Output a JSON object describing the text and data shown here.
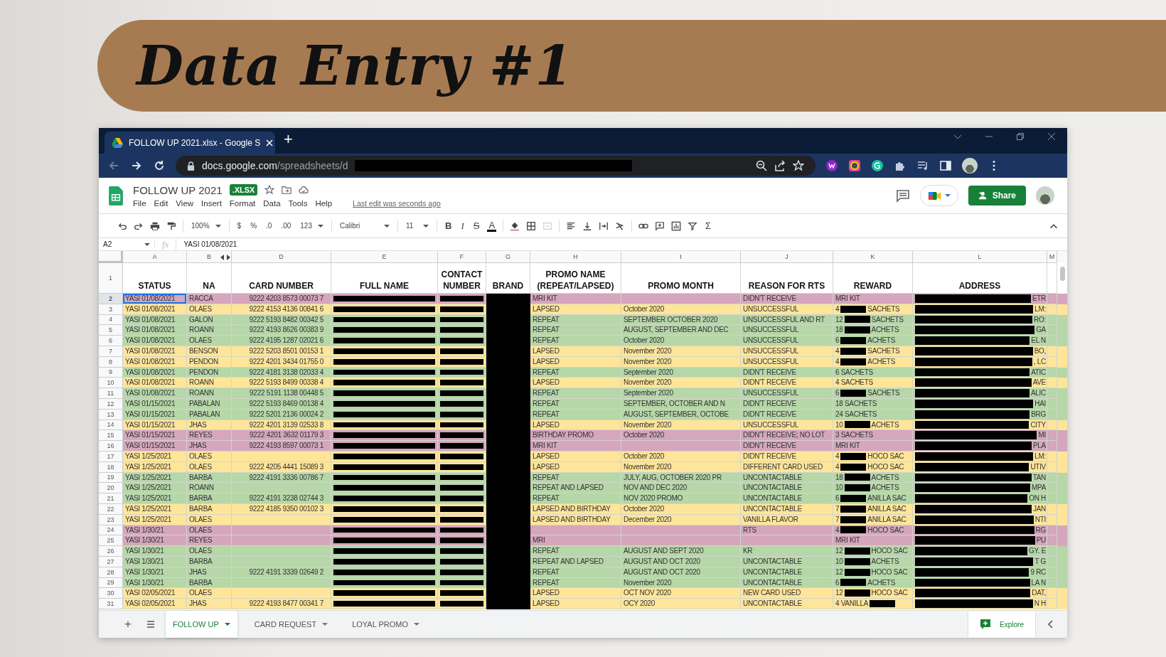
{
  "banner": {
    "title": "Data Entry #1"
  },
  "browser": {
    "tab_title": "FOLLOW UP 2021.xlsx - Google S",
    "new_tab": "+",
    "url_host": "docs.google.com",
    "url_path": "/spreadsheets/d"
  },
  "doc": {
    "title": "FOLLOW UP 2021",
    "badge": ".XLSX",
    "menus": [
      "File",
      "Edit",
      "View",
      "Insert",
      "Format",
      "Data",
      "Tools",
      "Help"
    ],
    "last_edit": "Last edit was seconds ago",
    "share": "Share"
  },
  "toolbar": {
    "zoom": "100%",
    "currency": "$",
    "percent": "%",
    "decrease_decimals": ".0",
    "increase_decimals": ".00",
    "number_format": "123",
    "font": "Calibri",
    "font_size": "11",
    "bold": "B",
    "italic": "I",
    "strikethrough": "S",
    "text_color": "A",
    "functions": "Σ"
  },
  "formula_bar": {
    "cell": "A2",
    "fx": "fx",
    "value": "YASI 01/08/2021"
  },
  "columns": [
    {
      "letter": "A",
      "label": "STATUS"
    },
    {
      "letter": "B",
      "label": "NA"
    },
    {
      "letter": "D",
      "label": "CARD NUMBER"
    },
    {
      "letter": "E",
      "label": "FULL NAME"
    },
    {
      "letter": "F",
      "label": "CONTACT NUMBER"
    },
    {
      "letter": "G",
      "label": "BRAND"
    },
    {
      "letter": "H",
      "label": "PROMO NAME (REPEAT/LAPSED)"
    },
    {
      "letter": "I",
      "label": "PROMO MONTH"
    },
    {
      "letter": "J",
      "label": "REASON FOR RTS"
    },
    {
      "letter": "K",
      "label": "REWARD"
    },
    {
      "letter": "L",
      "label": "ADDRESS"
    },
    {
      "letter": "M"
    }
  ],
  "header_row_number": "1",
  "rows": [
    {
      "n": "2",
      "color": "#d5a6bd",
      "selected": true,
      "redacted": true,
      "status": "YASI 01/08/2021",
      "na": "RACCA",
      "card": "9222 4203 8573 00073 7",
      "promo": "MRI KIT",
      "reason": "DIDN'T RECEIVE",
      "reward": {
        "lead": "MRI KIT",
        "redacted": false
      },
      "address_tail": "ETR"
    },
    {
      "n": "3",
      "color": "#ffe599",
      "selected": false,
      "redacted": true,
      "status": "YASI 01/08/2021",
      "na": "OLAES",
      "card": "9222 4153 4136 00841 6",
      "promo": "LAPSED",
      "month": "October 2020",
      "reason": "UNSUCCESSFUL",
      "reward": {
        "lead": "4",
        "redacted": true,
        "tail": "SACHETS"
      },
      "address_tail": "LM:"
    },
    {
      "n": "4",
      "color": "#b6d7a8",
      "selected": false,
      "redacted": true,
      "status": "YASI 01/08/2021",
      "na": "GALON",
      "card": "9222 5193 8482 00342 5",
      "promo": "REPEAT",
      "month": "SEPTEMBER OCTOBER 2020",
      "reason": "UNSUCCESSFUL AND RT",
      "reward": {
        "lead": "12",
        "redacted": true,
        "tail": "SACHETS"
      },
      "address_tail": "RO:"
    },
    {
      "n": "5",
      "color": "#b6d7a8",
      "selected": false,
      "redacted": true,
      "status": "YASI 01/08/2021",
      "na": "ROANN",
      "card": "9222 4193 8626 00383 9",
      "promo": "REPEAT",
      "month": "AUGUST, SEPTEMBER AND DEC",
      "reason": "UNSUCCESSFUL",
      "reward": {
        "lead": "18",
        "redacted": true,
        "tail": "ACHETS"
      },
      "address_tail": "GA"
    },
    {
      "n": "6",
      "color": "#b6d7a8",
      "selected": false,
      "redacted": true,
      "status": "YASI 01/08/2021",
      "na": "OLAES",
      "card": "9222 4195 1287 02021 6",
      "promo": "REPEAT",
      "month": "October 2020",
      "reason": "UNSUCCESSFUL",
      "reward": {
        "lead": "6",
        "redacted": true,
        "tail": "ACHETS"
      },
      "address_tail": "EL N"
    },
    {
      "n": "7",
      "color": "#ffe599",
      "selected": false,
      "redacted": true,
      "status": "YASI 01/08/2021",
      "na": "BENSON",
      "card": "9222 5203 8501 00153 1",
      "promo": "LAPSED",
      "month": "November 2020",
      "reason": "UNSUCCESSFUL",
      "reward": {
        "lead": "4",
        "redacted": true,
        "tail": "SACHETS"
      },
      "address_tail": "BO,"
    },
    {
      "n": "8",
      "color": "#ffe599",
      "selected": false,
      "redacted": true,
      "status": "YASI 01/08/2021",
      "na": "PENDON",
      "card": "9222 4201 3434 01755 0",
      "promo": "LAPSED",
      "month": "November 2020",
      "reason": "UNSUCCESSFUL",
      "reward": {
        "lead": "4",
        "redacted": true,
        "tail": "ACHETS"
      },
      "address_tail": ", LC"
    },
    {
      "n": "9",
      "color": "#b6d7a8",
      "selected": false,
      "redacted": true,
      "status": "YASI 01/08/2021",
      "na": "PENDON",
      "card": "9222 4181 3138 02033 4",
      "promo": "REPEAT",
      "month": "September 2020",
      "reason": "DIDN'T RECEIVE",
      "reward": {
        "lead": "6 SACHETS",
        "redacted": false
      },
      "address_tail": "ATIC"
    },
    {
      "n": "10",
      "color": "#ffe599",
      "selected": false,
      "redacted": true,
      "status": "YASI 01/08/2021",
      "na": "ROANN",
      "card": "9222 5193 8499 00338 4",
      "promo": "LAPSED",
      "month": "November 2020",
      "reason": "DIDN'T RECEIVE",
      "reward": {
        "lead": "4 SACHETS",
        "redacted": false
      },
      "address_tail": "AVE"
    },
    {
      "n": "11",
      "color": "#b6d7a8",
      "selected": false,
      "redacted": true,
      "status": "YASI 01/08/2021",
      "na": "ROANN",
      "card": "9222 5191 1138 00448 5",
      "promo": "REPEAT",
      "month": "September 2020",
      "reason": "UNSUCCESSFUL",
      "reward": {
        "lead": "6",
        "redacted": true,
        "tail": "SACHETS"
      },
      "address_tail": "ALIC"
    },
    {
      "n": "12",
      "color": "#b6d7a8",
      "selected": false,
      "redacted": true,
      "status": "YASI 01/15/2021",
      "na": "PABALAN",
      "card": "9222 5193 8469 00138 4",
      "promo": "REPEAT",
      "month": "SEPTEMBER, OCTOBER AND N",
      "reason": "DIDN'T RECEIVE",
      "reward": {
        "lead": "18 SACHETS",
        "redacted": false
      },
      "address_tail": "HAI"
    },
    {
      "n": "13",
      "color": "#b6d7a8",
      "selected": false,
      "redacted": true,
      "status": "YASI 01/15/2021",
      "na": "PABALAN",
      "card": "9222 5201 2136 00024 2",
      "promo": "REPEAT",
      "month": "AUGUST, SEPTEMBER, OCTOBE",
      "reason": "DIDN'T RECEIVE",
      "reward": {
        "lead": "24 SACHETS",
        "redacted": false
      },
      "address_tail": "BRG"
    },
    {
      "n": "14",
      "color": "#ffe599",
      "selected": false,
      "redacted": true,
      "status": "YASI 01/15/2021",
      "na": "JHAS",
      "card": "9222 4201 3139 02533 8",
      "promo": "LAPSED",
      "month": "November 2020",
      "reason": "UNSUCCESSFUL",
      "reward": {
        "lead": "10",
        "redacted": true,
        "tail": "ACHETS"
      },
      "address_tail": "CITY"
    },
    {
      "n": "15",
      "color": "#d5a6bd",
      "selected": false,
      "redacted": true,
      "status": "YASI 01/15/2021",
      "na": "REYES",
      "card": "9222 4201 3632 01179 3",
      "promo": "BIRTHDAY PROMO",
      "month": "October 2020",
      "reason": "DIDN'T RECEIVE; NO LOT",
      "reward": {
        "lead": "3 SACHETS",
        "redacted": false
      },
      "address_tail": "MI"
    },
    {
      "n": "16",
      "color": "#d5a6bd",
      "selected": false,
      "redacted": true,
      "status": "YASI 01/15/2021",
      "na": "JHAS",
      "card": "9222 4193 8597 00073 1",
      "promo": "MRI KIT",
      "reason": "DIDN'T RECEIVE",
      "reward": {
        "lead": "MRI KIT",
        "redacted": false
      },
      "address_tail": "PLA"
    },
    {
      "n": "17",
      "color": "#ffe599",
      "selected": false,
      "redacted": true,
      "status": "YASI 1/25/2021",
      "na": "OLAES",
      "promo": "LAPSED",
      "month": "October 2020",
      "reason": "DIDN'T RECEIVE",
      "reward": {
        "lead": "4",
        "redacted": true,
        "tail": "HOCO SAC"
      },
      "address_tail": "LM:"
    },
    {
      "n": "18",
      "color": "#ffe599",
      "selected": false,
      "redacted": true,
      "status": "YASI 1/25/2021",
      "na": "OLAES",
      "card": "9222 4205 4441 15089 3",
      "promo": "LAPSED",
      "month": "November 2020",
      "reason": "DIFFERENT CARD USED",
      "reward": {
        "lead": "4",
        "redacted": true,
        "tail": "HOCO SAC"
      },
      "address_tail": "UTIV"
    },
    {
      "n": "19",
      "color": "#b6d7a8",
      "selected": false,
      "redacted": true,
      "status": "YASI 1/25/2021",
      "na": "BARBA",
      "card": "9222 4191 3336 00786 7",
      "promo": "REPEAT",
      "month": "JULY, AUG, OCTOBER 2020 PR",
      "reason": "UNCONTACTABLE",
      "reward": {
        "lead": "18",
        "redacted": true,
        "tail": "ACHETS"
      },
      "address_tail": "TAN"
    },
    {
      "n": "20",
      "color": "#b6d7a8",
      "selected": false,
      "redacted": true,
      "status": "YASI 1/25/2021",
      "na": "ROANN",
      "promo": "REPEAT AND LAPSED",
      "month": "NOV AND DEC 2020",
      "reason": "UNCONTACTABLE",
      "reward": {
        "lead": "10",
        "redacted": true,
        "tail": "ACHETS"
      },
      "address_tail": "MPA"
    },
    {
      "n": "21",
      "color": "#b6d7a8",
      "selected": false,
      "redacted": true,
      "status": "YASI 1/25/2021",
      "na": "BARBA",
      "card": "9222 4191 3238 02744 3",
      "promo": "REPEAT",
      "month": "NOV 2020 PROMO",
      "reason": "UNCONTACTABLE",
      "reward": {
        "lead": "6",
        "redacted": true,
        "tail": "ANILLA SAC"
      },
      "address_tail": "ON H"
    },
    {
      "n": "22",
      "color": "#ffe599",
      "selected": false,
      "redacted": true,
      "status": "YASI 1/25/2021",
      "na": "BARBA",
      "card": "9222 4185 9350 00102 3",
      "promo": "LAPSED AND BIRTHDAY",
      "month": "October 2020",
      "reason": "UNCONTACTABLE",
      "reward": {
        "lead": "7",
        "redacted": true,
        "tail": "ANILLA SAC"
      },
      "address_tail": "JAN"
    },
    {
      "n": "23",
      "color": "#ffe599",
      "selected": false,
      "redacted": true,
      "status": "YASI 1/25/2021",
      "na": "OLAES",
      "promo": "LAPSED AND BIRTHDAY",
      "month": "December 2020",
      "reason": "VANILLA FLAVOR",
      "reward": {
        "lead": "7",
        "redacted": true,
        "tail": "ANILLA SAC"
      },
      "address_tail": "NTI"
    },
    {
      "n": "24",
      "color": "#d5a6bd",
      "selected": false,
      "redacted": true,
      "status": "YASI 1/30/21",
      "na": "OLAES",
      "reason": "RTS",
      "reward": {
        "lead": "4",
        "redacted": true,
        "tail": "HOCO SAC"
      },
      "address_tail": "RG"
    },
    {
      "n": "25",
      "color": "#d5a6bd",
      "selected": false,
      "redacted": true,
      "status": "YASI 1/30/21",
      "na": "REYES",
      "promo": "MRI",
      "reward": {
        "lead": "MRI KIT",
        "redacted": false
      },
      "address_tail": "PU"
    },
    {
      "n": "26",
      "color": "#b6d7a8",
      "selected": false,
      "redacted": true,
      "status": "YASI 1/30/21",
      "na": "OLAES",
      "promo": "REPEAT",
      "month": "AUGUST AND SEPT 2020",
      "reason": "KR",
      "reward": {
        "lead": "12",
        "redacted": true,
        "tail": "HOCO SAC"
      },
      "address_tail": "GY. E"
    },
    {
      "n": "27",
      "color": "#b6d7a8",
      "selected": false,
      "redacted": true,
      "status": "YASI 1/30/21",
      "na": "BARBA",
      "promo": "REPEAT AND LAPSED",
      "month": "AUGUST AND OCT 2020",
      "reason": "UNCONTACTABLE",
      "reward": {
        "lead": "10",
        "redacted": true,
        "tail": "ACHETS"
      },
      "address_tail": "T G"
    },
    {
      "n": "28",
      "color": "#b6d7a8",
      "selected": false,
      "redacted": true,
      "status": "YASI 1/30/21",
      "na": "JHAS",
      "card": "9222 4191 3339 02649 2",
      "promo": "REPEAT",
      "month": "AUGUST AND OCT 2020",
      "reason": "UNCONTACTABLE",
      "reward": {
        "lead": "12",
        "redacted": true,
        "tail": "HOCO SAC"
      },
      "address_tail": "9 RC"
    },
    {
      "n": "29",
      "color": "#b6d7a8",
      "selected": false,
      "redacted": true,
      "status": "YASI 1/30/21",
      "na": "BARBA",
      "promo": "REPEAT",
      "month": "November 2020",
      "reason": "UNCONTACTABLE",
      "reward": {
        "lead": "6",
        "redacted": true,
        "tail": "ACHETS"
      },
      "address_tail": "LA N"
    },
    {
      "n": "30",
      "color": "#ffe599",
      "selected": false,
      "redacted": true,
      "status": "YASI 02/05/2021",
      "na": "OLAES",
      "promo": "LAPSED",
      "month": "OCT NOV 2020",
      "reason": "NEW CARD USED",
      "reward": {
        "lead": "12",
        "redacted": true,
        "tail": "HOCO SAC"
      },
      "address_tail": "DAT,"
    },
    {
      "n": "31",
      "color": "#ffe599",
      "selected": false,
      "redacted": true,
      "status": "YASI 02/05/2021",
      "na": "JHAS",
      "card": "9222 4193 8477 00341 7",
      "promo": "LAPSED",
      "month": "OCY 2020",
      "reason": "UNCONTACTABLE",
      "reward": {
        "lead": "4 VANILLA",
        "redacted": true
      },
      "address_tail": "N H"
    }
  ],
  "add_sheet": "+",
  "sheet_tabs": [
    {
      "label": "FOLLOW UP",
      "selected": true
    },
    {
      "label": "CARD REQUEST",
      "selected": false
    },
    {
      "label": "LOYAL PROMO",
      "selected": false
    }
  ],
  "explore": "Explore"
}
